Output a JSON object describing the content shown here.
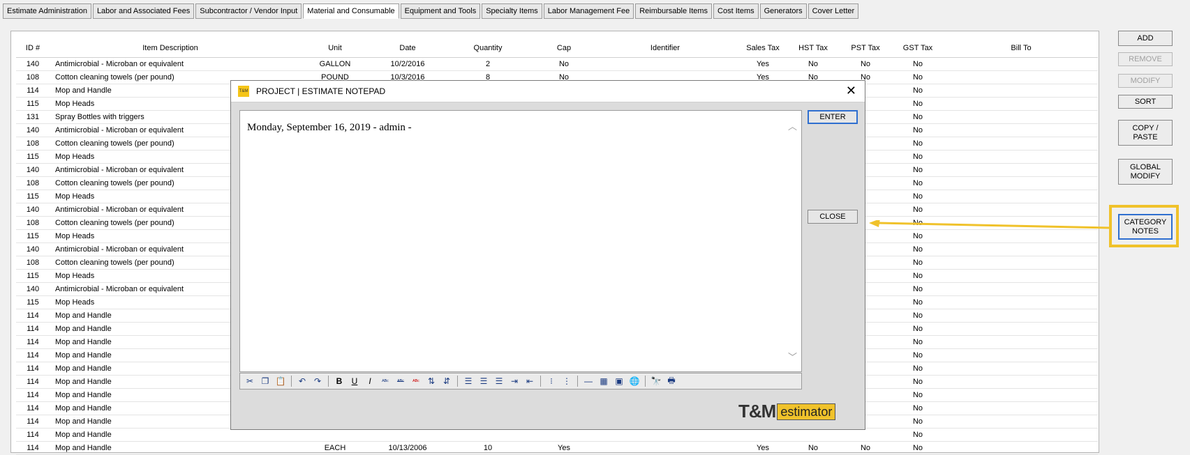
{
  "tabs": [
    {
      "label": "Estimate Administration"
    },
    {
      "label": "Labor and Associated Fees"
    },
    {
      "label": "Subcontractor / Vendor Input"
    },
    {
      "label": "Material and Consumable"
    },
    {
      "label": "Equipment and Tools"
    },
    {
      "label": "Specialty Items"
    },
    {
      "label": "Labor Management Fee"
    },
    {
      "label": "Reimbursable Items"
    },
    {
      "label": "Cost Items"
    },
    {
      "label": "Generators"
    },
    {
      "label": "Cover Letter"
    }
  ],
  "columns": {
    "id": "ID #",
    "desc": "Item Description",
    "unit": "Unit",
    "date": "Date",
    "qty": "Quantity",
    "cap": "Cap",
    "ident": "Identifier",
    "sales": "Sales Tax",
    "hst": "HST Tax",
    "pst": "PST Tax",
    "gst": "GST Tax",
    "bill": "Bill To"
  },
  "rows": [
    {
      "id": "140",
      "desc": "Antimicrobial - Microban or equivalent",
      "unit": "GALLON",
      "date": "10/2/2016",
      "qty": "2",
      "cap": "No",
      "sales": "Yes",
      "hst": "No",
      "pst": "No",
      "gst": "No"
    },
    {
      "id": "108",
      "desc": "Cotton cleaning towels (per pound)",
      "unit": "POUND",
      "date": "10/3/2016",
      "qty": "8",
      "cap": "No",
      "sales": "Yes",
      "hst": "No",
      "pst": "No",
      "gst": "No"
    },
    {
      "id": "114",
      "desc": "Mop  and Handle",
      "gst": "No"
    },
    {
      "id": "115",
      "desc": "Mop Heads",
      "gst": "No"
    },
    {
      "id": "131",
      "desc": "Spray Bottles with triggers",
      "gst": "No"
    },
    {
      "id": "140",
      "desc": "Antimicrobial - Microban or equivalent",
      "gst": "No"
    },
    {
      "id": "108",
      "desc": "Cotton cleaning towels (per pound)",
      "gst": "No"
    },
    {
      "id": "115",
      "desc": "Mop Heads",
      "gst": "No"
    },
    {
      "id": "140",
      "desc": "Antimicrobial - Microban or equivalent",
      "gst": "No"
    },
    {
      "id": "108",
      "desc": "Cotton cleaning towels (per pound)",
      "gst": "No"
    },
    {
      "id": "115",
      "desc": "Mop Heads",
      "gst": "No"
    },
    {
      "id": "140",
      "desc": "Antimicrobial - Microban or equivalent",
      "gst": "No"
    },
    {
      "id": "108",
      "desc": "Cotton cleaning towels (per pound)",
      "gst": "No"
    },
    {
      "id": "115",
      "desc": "Mop Heads",
      "gst": "No"
    },
    {
      "id": "140",
      "desc": "Antimicrobial - Microban or equivalent",
      "gst": "No"
    },
    {
      "id": "108",
      "desc": "Cotton cleaning towels (per pound)",
      "gst": "No"
    },
    {
      "id": "115",
      "desc": "Mop Heads",
      "gst": "No"
    },
    {
      "id": "140",
      "desc": "Antimicrobial - Microban or equivalent",
      "gst": "No"
    },
    {
      "id": "115",
      "desc": "Mop Heads",
      "gst": "No"
    },
    {
      "id": "114",
      "desc": "Mop  and Handle",
      "gst": "No"
    },
    {
      "id": "114",
      "desc": "Mop  and Handle",
      "gst": "No"
    },
    {
      "id": "114",
      "desc": "Mop  and Handle",
      "gst": "No"
    },
    {
      "id": "114",
      "desc": "Mop  and Handle",
      "gst": "No"
    },
    {
      "id": "114",
      "desc": "Mop  and Handle",
      "gst": "No"
    },
    {
      "id": "114",
      "desc": "Mop  and Handle",
      "gst": "No"
    },
    {
      "id": "114",
      "desc": "Mop  and Handle",
      "gst": "No"
    },
    {
      "id": "114",
      "desc": "Mop  and Handle",
      "gst": "No"
    },
    {
      "id": "114",
      "desc": "Mop  and Handle",
      "gst": "No"
    },
    {
      "id": "114",
      "desc": "Mop  and Handle",
      "gst": "No"
    },
    {
      "id": "114",
      "desc": "Mop  and Handle",
      "unit": "EACH",
      "date": "10/13/2006",
      "qty": "10",
      "cap": "Yes",
      "sales": "Yes",
      "hst": "No",
      "pst": "No",
      "gst": "No"
    }
  ],
  "sidebar": {
    "add": "ADD",
    "remove": "REMOVE",
    "modify": "MODIFY",
    "sort": "SORT",
    "copy_paste": [
      "COPY /",
      "PASTE"
    ],
    "global_modify": [
      "GLOBAL",
      "MODIFY"
    ],
    "category_notes": [
      "CATEGORY",
      "NOTES"
    ]
  },
  "dialog": {
    "icon_text": "T&M",
    "title": "PROJECT | ESTIMATE NOTEPAD",
    "content": "Monday, September 16, 2019 - admin -",
    "enter": "ENTER",
    "close": "CLOSE",
    "brand_tm": "T&M",
    "brand_est": "estimator"
  },
  "colors": {
    "highlight": "#f0c22b",
    "focus_border": "#2f6fd0"
  }
}
